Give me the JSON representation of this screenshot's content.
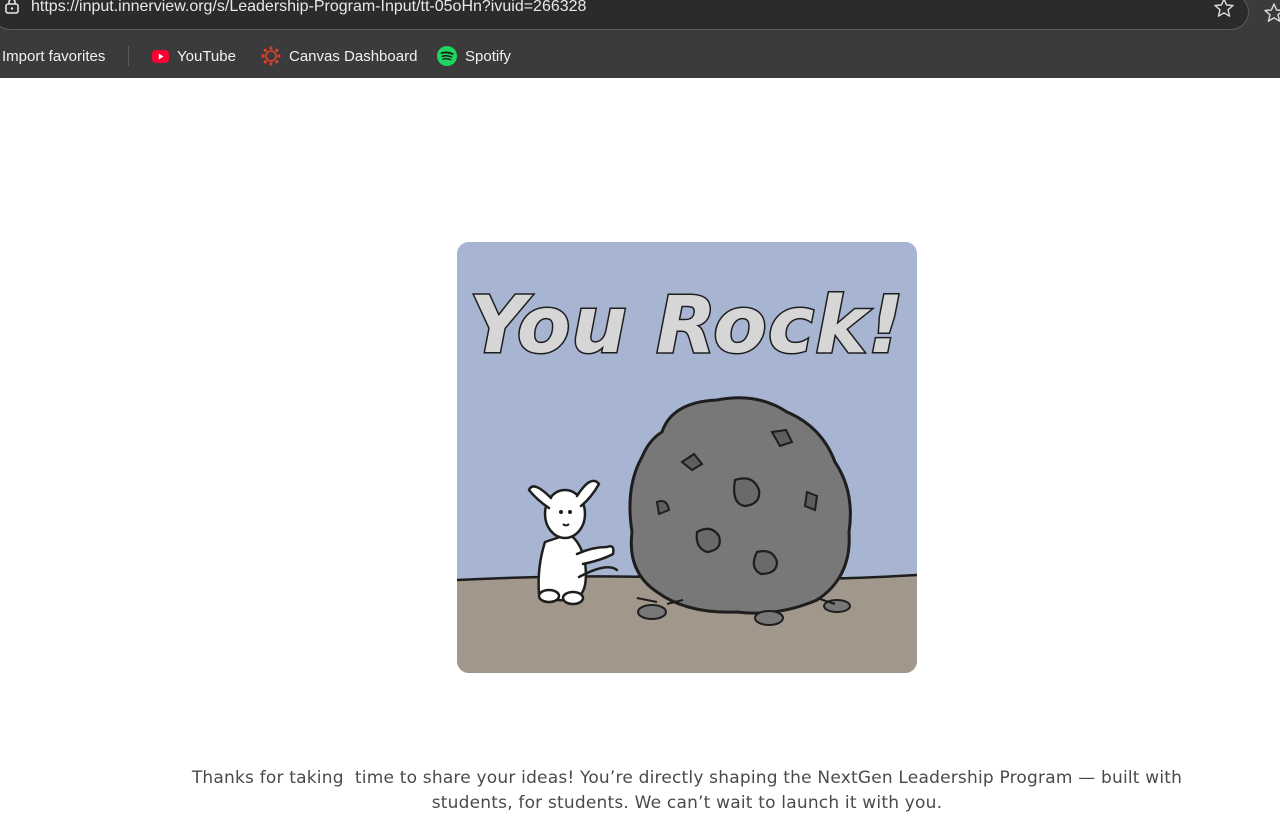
{
  "browser": {
    "url": "https://input.innerview.org/s/Leadership-Program-Input/tt-05oHn?ivuid=266328",
    "bookmarks": [
      {
        "label": "Import favorites",
        "icon": "none"
      },
      {
        "label": "YouTube",
        "icon": "youtube-icon"
      },
      {
        "label": "Canvas Dashboard",
        "icon": "canvas-icon"
      },
      {
        "label": "Spotify",
        "icon": "spotify-icon"
      }
    ]
  },
  "page": {
    "image_text": "You Rock!",
    "thank_you_message": "Thanks for taking  time to share your ideas! You’re directly shaping the NextGen Leadership Program — built with students, for students. We can’t wait to launch it with you."
  },
  "colors": {
    "youtube": "#ff0033",
    "canvas": "#e13f2b",
    "spotify": "#1ed760",
    "illustration_sky": "#a7b5d2",
    "illustration_ground": "#a2978b"
  }
}
